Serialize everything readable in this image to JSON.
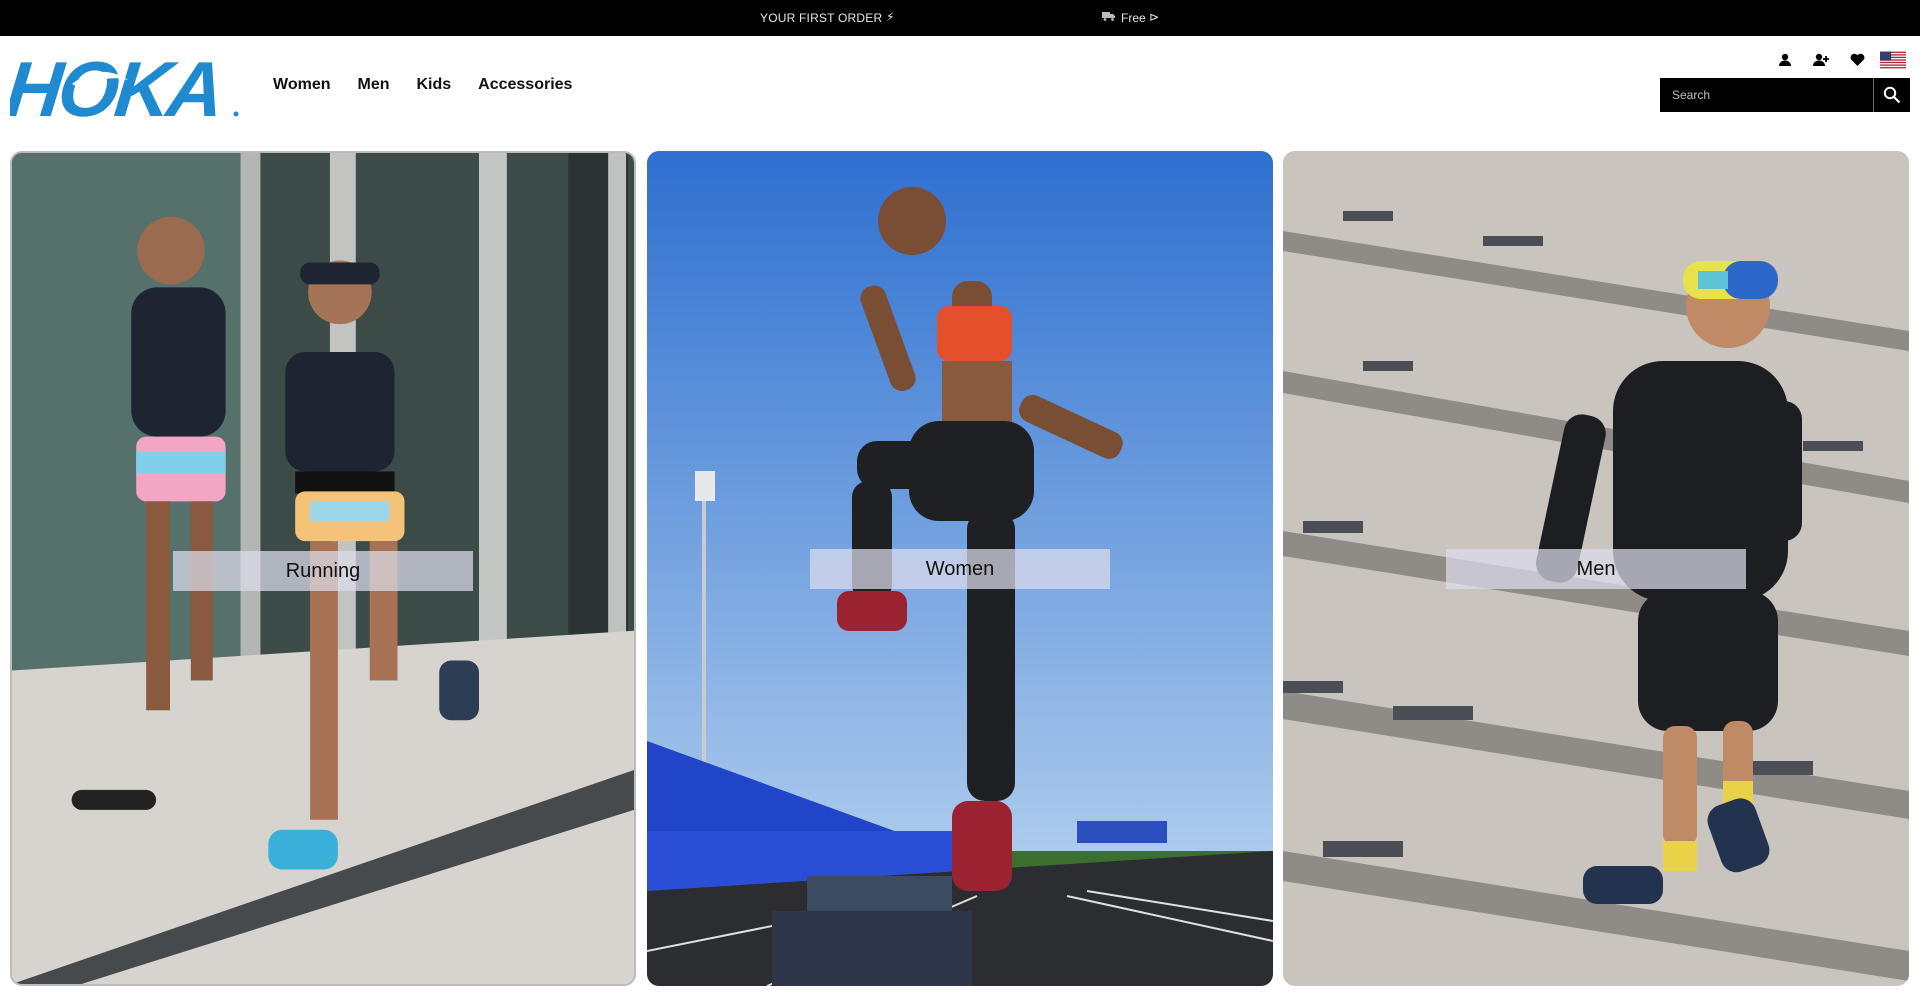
{
  "announcement": {
    "message_1": "YOUR FIRST ORDER",
    "bolt_icon": "lightning-icon",
    "truck_icon": "truck-icon",
    "message_2": "Free",
    "arrow_icon": "arrow-icon"
  },
  "header": {
    "logo_text": "HOKA",
    "nav": [
      "Women",
      "Men",
      "Kids",
      "Accessories"
    ],
    "icons": [
      "account-icon",
      "add-user-icon",
      "heart-icon",
      "us-flag-icon"
    ],
    "search": {
      "placeholder": "Search",
      "button_icon": "search-icon"
    }
  },
  "tiles": [
    {
      "label": "Running",
      "scene": "two runners on city sidewalk"
    },
    {
      "label": "Women",
      "scene": "woman jumping on stadium box"
    },
    {
      "label": "Men",
      "scene": "man running on concrete steps"
    }
  ],
  "colors": {
    "brand_blue": "#1f8ad0",
    "bar_black": "#000000"
  }
}
